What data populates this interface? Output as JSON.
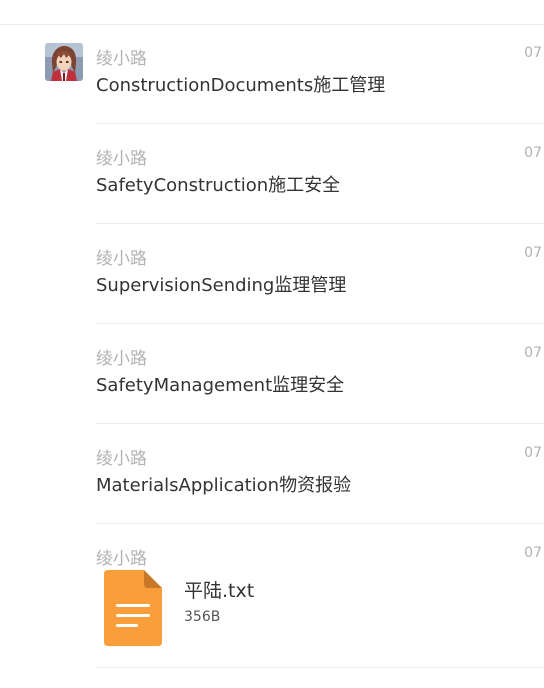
{
  "messages": [
    {
      "sender": "绫小路",
      "time": "07",
      "text": "ConstructionDocuments施工管理"
    },
    {
      "sender": "绫小路",
      "time": "07",
      "text": "SafetyConstruction施工安全"
    },
    {
      "sender": "绫小路",
      "time": "07",
      "text": "SupervisionSending监理管理"
    },
    {
      "sender": "绫小路",
      "time": "07",
      "text": "SafetyManagement监理安全"
    },
    {
      "sender": "绫小路",
      "time": "07",
      "text": "MaterialsApplication物资报验"
    }
  ],
  "file_message": {
    "sender": "绫小路",
    "time": "07",
    "file_name": "平陆.txt",
    "file_size": "356B",
    "icon": "text-file-icon",
    "icon_color": "#fa9d3b"
  },
  "colors": {
    "sender": "#b2b2b2",
    "text": "#333333",
    "divider": "#ebebeb"
  }
}
